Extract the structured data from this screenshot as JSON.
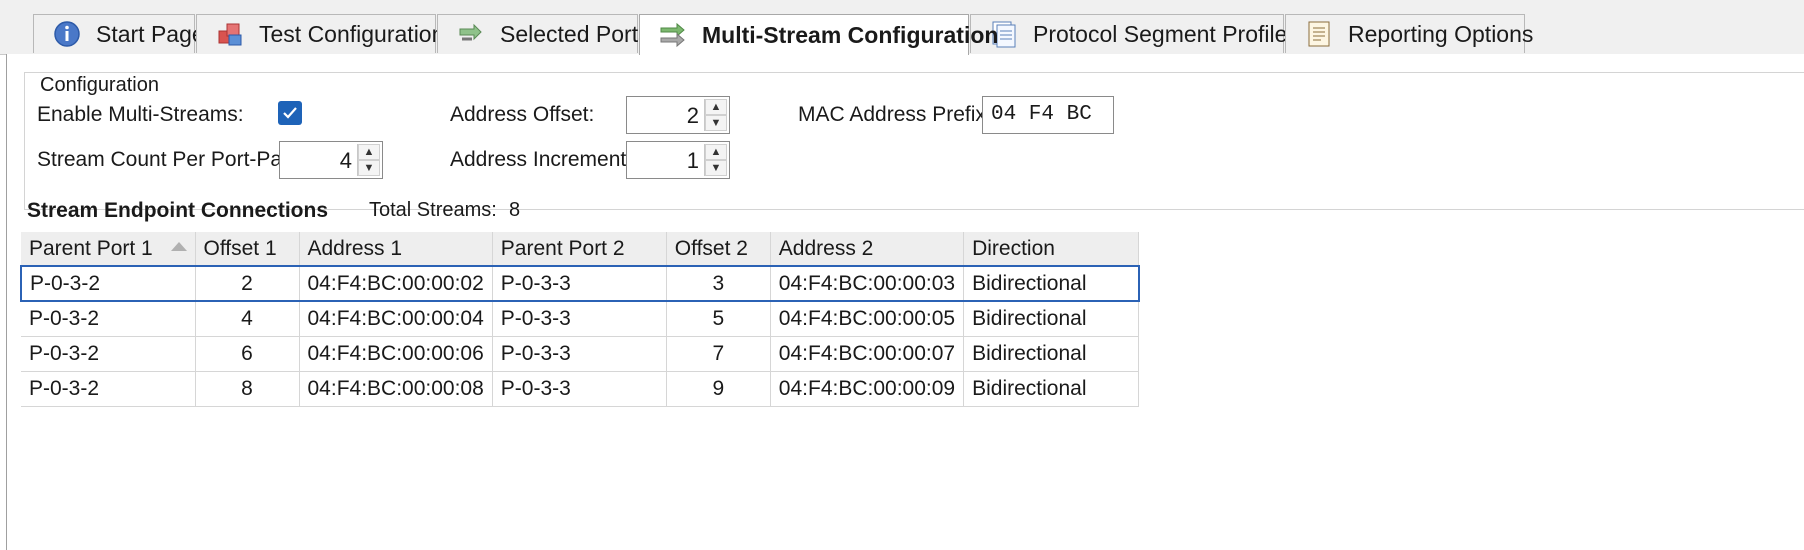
{
  "tabs": [
    {
      "label": "Start Page",
      "icon": "info-icon",
      "active": false
    },
    {
      "label": "Test Configuration",
      "icon": "cubes-icon",
      "active": false
    },
    {
      "label": "Selected Ports",
      "icon": "ports-arrows-icon",
      "active": false
    },
    {
      "label": "Multi-Stream Configuration",
      "icon": "multi-stream-icon",
      "active": true
    },
    {
      "label": "Protocol Segment Profiles",
      "icon": "profiles-icon",
      "active": false
    },
    {
      "label": "Reporting Options",
      "icon": "report-icon",
      "active": false
    }
  ],
  "config": {
    "legend": "Configuration",
    "enable_label": "Enable Multi-Streams:",
    "enable_checked": true,
    "stream_count_label": "Stream Count Per Port-Pair:",
    "stream_count_value": "4",
    "address_offset_label": "Address Offset:",
    "address_offset_value": "2",
    "address_increment_label": "Address Increment:",
    "address_increment_value": "1",
    "mac_prefix_label": "MAC Address Prefix:",
    "mac_prefix_value": "04 F4 BC"
  },
  "connections": {
    "title": "Stream Endpoint Connections",
    "total_label": "Total Streams:",
    "total_value": "8",
    "columns": [
      "Parent Port 1",
      "Offset 1",
      "Address 1",
      "Parent Port 2",
      "Offset 2",
      "Address 2",
      "Direction"
    ],
    "rows": [
      [
        "P-0-3-2",
        "2",
        "04:F4:BC:00:00:02",
        "P-0-3-3",
        "3",
        "04:F4:BC:00:00:03",
        "Bidirectional"
      ],
      [
        "P-0-3-2",
        "4",
        "04:F4:BC:00:00:04",
        "P-0-3-3",
        "5",
        "04:F4:BC:00:00:05",
        "Bidirectional"
      ],
      [
        "P-0-3-2",
        "6",
        "04:F4:BC:00:00:06",
        "P-0-3-3",
        "7",
        "04:F4:BC:00:00:07",
        "Bidirectional"
      ],
      [
        "P-0-3-2",
        "8",
        "04:F4:BC:00:00:08",
        "P-0-3-3",
        "9",
        "04:F4:BC:00:00:09",
        "Bidirectional"
      ]
    ],
    "selected_row": 0
  },
  "colors": {
    "accent": "#1e63b8",
    "selection_border": "#2b62b5"
  }
}
